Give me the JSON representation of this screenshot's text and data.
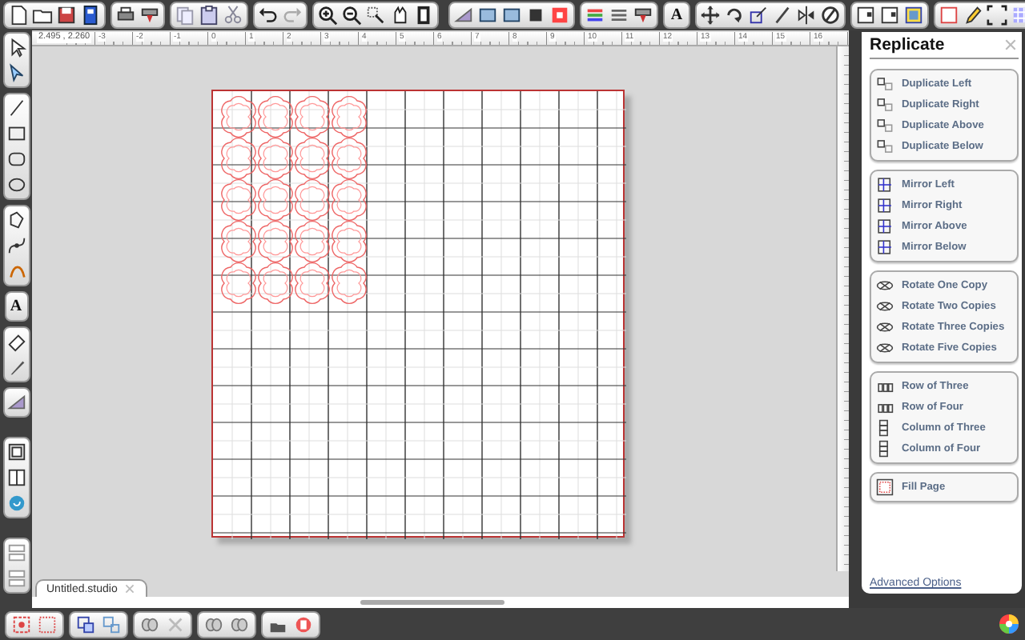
{
  "top_toolbar": {
    "text_tool_label": "A"
  },
  "ruler": {
    "coordinates": "2.495 , 2.260",
    "labels": [
      "-3",
      "-2",
      "-1",
      "0",
      "1",
      "2",
      "3",
      "4",
      "5",
      "6",
      "7",
      "8",
      "9",
      "10",
      "11",
      "12",
      "13",
      "14",
      "15",
      "16"
    ]
  },
  "tools": {
    "text_tool_label": "A"
  },
  "document_tab": {
    "title": "Untitled.studio",
    "selected": true
  },
  "panel": {
    "title": "Replicate",
    "groups": [
      [
        {
          "label": "Duplicate Left"
        },
        {
          "label": "Duplicate Right"
        },
        {
          "label": "Duplicate Above"
        },
        {
          "label": "Duplicate Below"
        }
      ],
      [
        {
          "label": "Mirror Left"
        },
        {
          "label": "Mirror Right"
        },
        {
          "label": "Mirror Above"
        },
        {
          "label": "Mirror Below"
        }
      ],
      [
        {
          "label": "Rotate One Copy"
        },
        {
          "label": "Rotate Two Copies"
        },
        {
          "label": "Rotate Three Copies"
        },
        {
          "label": "Rotate Five Copies"
        }
      ],
      [
        {
          "label": "Row of Three"
        },
        {
          "label": "Row of Four"
        },
        {
          "label": "Column of Three"
        },
        {
          "label": "Column of Four"
        }
      ],
      [
        {
          "label": "Fill Page"
        }
      ]
    ],
    "link": "Advanced Options"
  }
}
